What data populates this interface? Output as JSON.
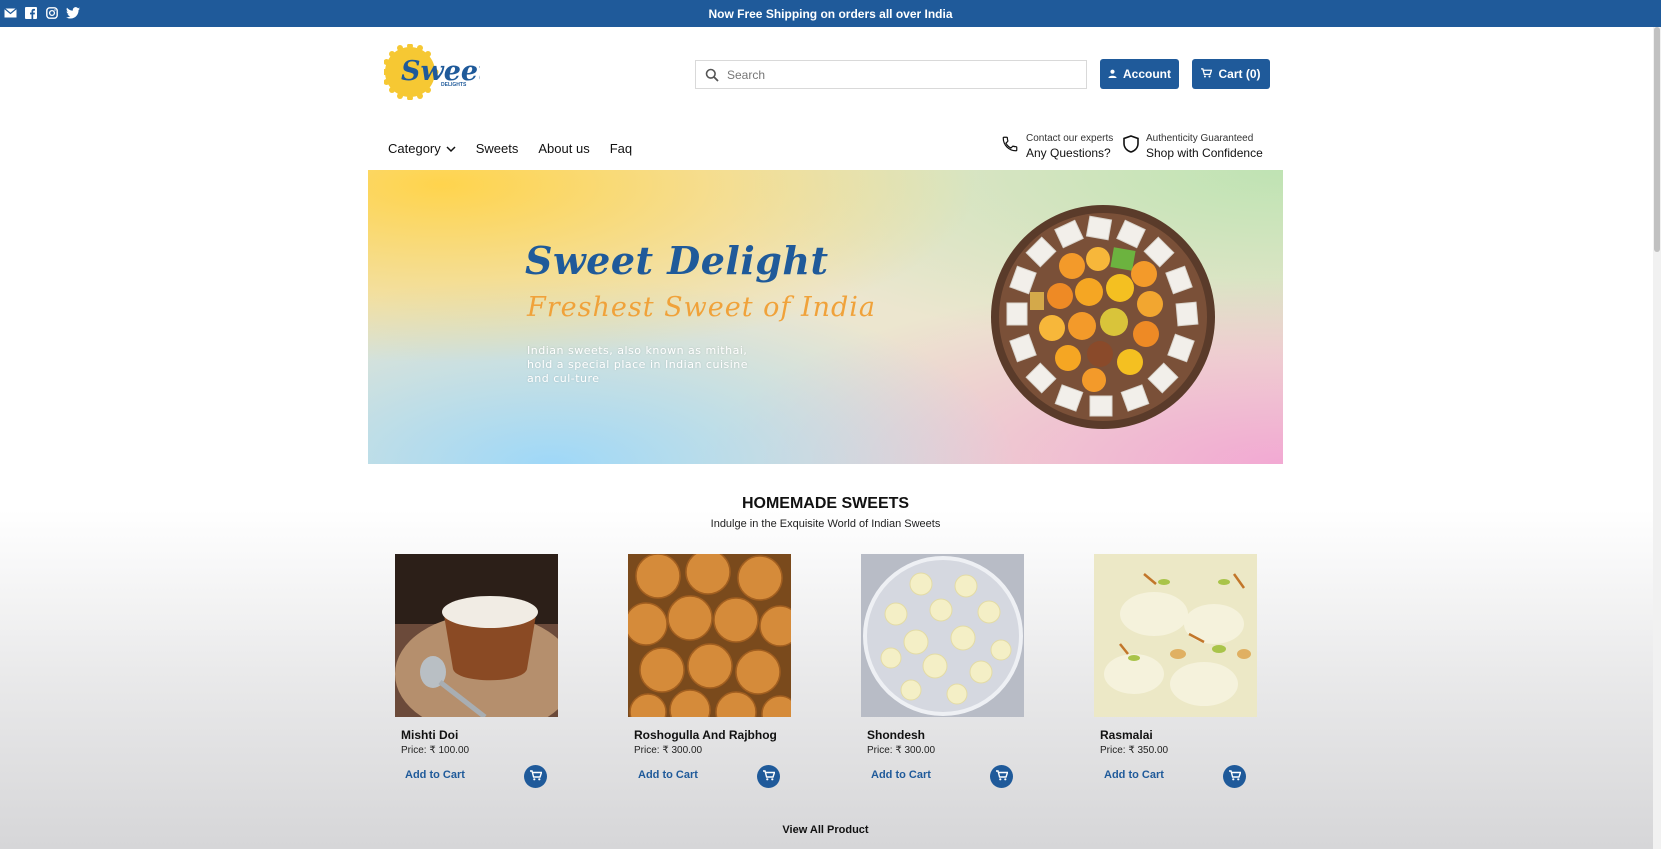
{
  "topbar": {
    "shipping_text": "Now Free Shipping on orders all over India",
    "social_icons": [
      "mail-icon",
      "facebook-icon",
      "instagram-icon",
      "twitter-icon"
    ]
  },
  "header": {
    "logo_text": "Sweet",
    "logo_subtext": "DELIGHTS",
    "search_placeholder": "Search",
    "account_label": "Account",
    "cart_label": "Cart (0)"
  },
  "nav": {
    "items": [
      {
        "label": "Category",
        "has_dropdown": true
      },
      {
        "label": "Sweets"
      },
      {
        "label": "About us"
      },
      {
        "label": "Faq"
      }
    ],
    "contact": {
      "small": "Contact our experts",
      "big": "Any Questions?"
    },
    "authenticity": {
      "small": "Authenticity Guaranteed",
      "big": "Shop with Confidence"
    }
  },
  "hero": {
    "title": "Sweet Delight",
    "subtitle": "Freshest Sweet of India",
    "description": "Indian sweets, also known as mithai, hold a special place in Indian cuisine and cul-ture"
  },
  "section": {
    "title": "HOMEMADE SWEETS",
    "subtitle": "Indulge in the Exquisite World of Indian Sweets"
  },
  "products": [
    {
      "name": "Mishti Doi",
      "price": "Price: ₹ 100.00",
      "add_label": "Add to Cart"
    },
    {
      "name": "Roshogulla And Rajbhog",
      "price": "Price: ₹ 300.00",
      "add_label": "Add to Cart"
    },
    {
      "name": "Shondesh",
      "price": "Price: ₹ 300.00",
      "add_label": "Add to Cart"
    },
    {
      "name": "Rasmalai",
      "price": "Price: ₹ 350.00",
      "add_label": "Add to Cart"
    }
  ],
  "view_all_label": "View All Product",
  "colors": {
    "brand": "#1f5a9a",
    "accent": "#f0a23a",
    "logo_yellow": "#f6c833"
  }
}
